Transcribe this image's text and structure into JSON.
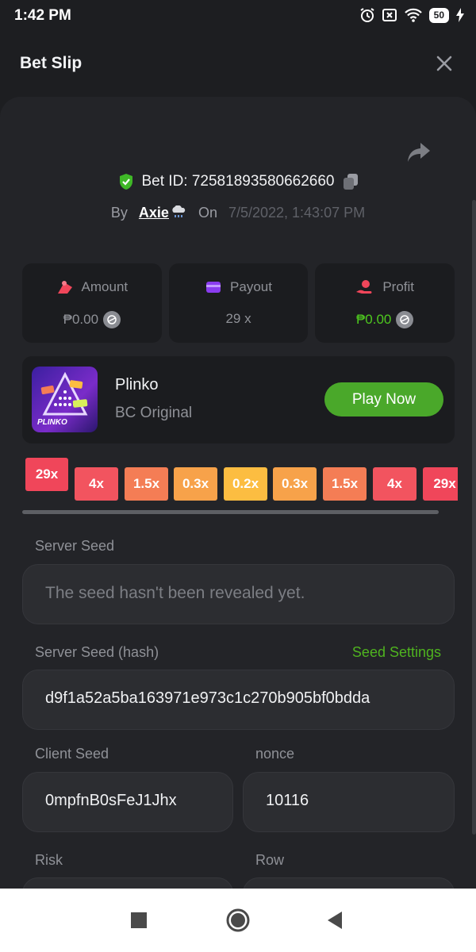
{
  "status_bar": {
    "time": "1:42 PM",
    "battery": "50"
  },
  "header": {
    "title": "Bet Slip"
  },
  "bet": {
    "id_label": "Bet ID: 72581893580662660",
    "by_label": "By",
    "user": "Axie",
    "on_label": "On",
    "date": "7/5/2022, 1:43:07 PM"
  },
  "stats": [
    {
      "label": "Amount",
      "value": "₱0.00",
      "icon": "amount-icon",
      "color": "#8f9197"
    },
    {
      "label": "Payout",
      "value": "29 x",
      "icon": "payout-icon",
      "color": "#8f9197"
    },
    {
      "label": "Profit",
      "value": "₱0.00",
      "icon": "profit-icon",
      "color": "#4ec81f"
    }
  ],
  "game": {
    "title": "Plinko",
    "subtitle": "BC Original",
    "play_label": "Play Now",
    "thumb_label": "PLINKO"
  },
  "multipliers": [
    {
      "label": "29x",
      "color": "#f0465a",
      "active": true
    },
    {
      "label": "4x",
      "color": "#f2545f"
    },
    {
      "label": "1.5x",
      "color": "#f47d55"
    },
    {
      "label": "0.3x",
      "color": "#f7a24a"
    },
    {
      "label": "0.2x",
      "color": "#fcbd41"
    },
    {
      "label": "0.3x",
      "color": "#f7a24a"
    },
    {
      "label": "1.5x",
      "color": "#f47d55"
    },
    {
      "label": "4x",
      "color": "#f2545f"
    },
    {
      "label": "29x",
      "color": "#f0465a"
    }
  ],
  "fields": {
    "server_seed_label": "Server Seed",
    "server_seed_value": "The seed hasn't been revealed yet.",
    "server_seed_hash_label": "Server Seed (hash)",
    "seed_settings_label": "Seed Settings",
    "server_seed_hash_value": "d9f1a52a5ba163971e973c1c270b905bf0bdda",
    "client_seed_label": "Client Seed",
    "client_seed_value": "0mpfnB0sFeJ1Jhx",
    "nonce_label": "nonce",
    "nonce_value": "10116",
    "risk_label": "Risk",
    "row_label": "Row"
  },
  "colors": {
    "accent_green": "#4aa82a",
    "background": "#1d1e21",
    "card": "#1b1c1f"
  }
}
